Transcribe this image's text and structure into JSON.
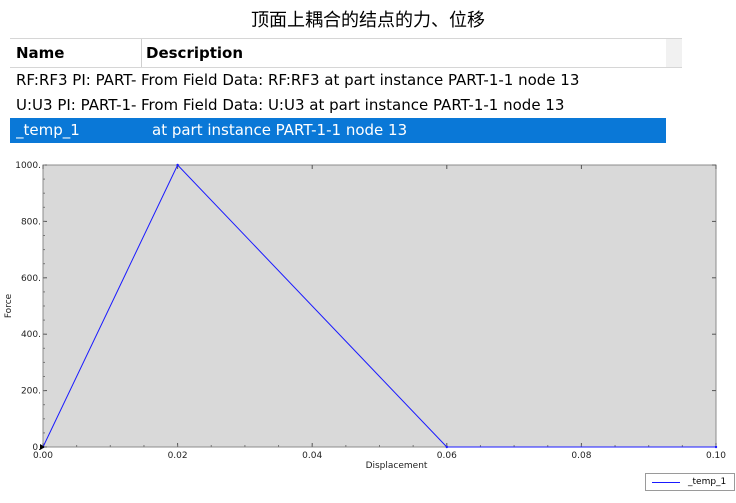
{
  "caption": "顶面上耦合的结点的力、位移",
  "table": {
    "headers": {
      "name": "Name",
      "description": "Description"
    },
    "rows": [
      {
        "name": "RF:RF3 PI: PART-",
        "description": "From Field Data: RF:RF3  at part instance PART-1-1 node 13",
        "selected": false
      },
      {
        "name": "U:U3 PI: PART-1-",
        "description": "From Field Data: U:U3  at part instance PART-1-1 node 13",
        "selected": false
      },
      {
        "name": "_temp_1",
        "description": "at part instance PART-1-1 node 13",
        "selected": true
      }
    ]
  },
  "colors": {
    "selection": "#0a78d7",
    "plot_bg": "#d9d9d9",
    "series": "#1a1aff"
  },
  "chart_data": {
    "type": "line",
    "xlabel": "Displacement",
    "ylabel": "Force",
    "xlim": [
      0,
      0.1
    ],
    "ylim": [
      0,
      1000
    ],
    "x_ticks": [
      0,
      0.02,
      0.04,
      0.06,
      0.08,
      0.1
    ],
    "x_tick_labels": [
      "0.00",
      "0.02",
      "0.04",
      "0.06",
      "0.08",
      "0.10"
    ],
    "y_ticks": [
      0,
      200,
      400,
      600,
      800,
      1000
    ],
    "y_tick_labels": [
      "0.",
      "200.",
      "400.",
      "600.",
      "800.",
      "1000."
    ],
    "grid": false,
    "legend_position": "bottom-right",
    "series": [
      {
        "name": "_temp_1",
        "x": [
          0,
          0.02,
          0.06,
          0.1
        ],
        "y": [
          0,
          1000,
          0,
          0
        ]
      }
    ]
  }
}
